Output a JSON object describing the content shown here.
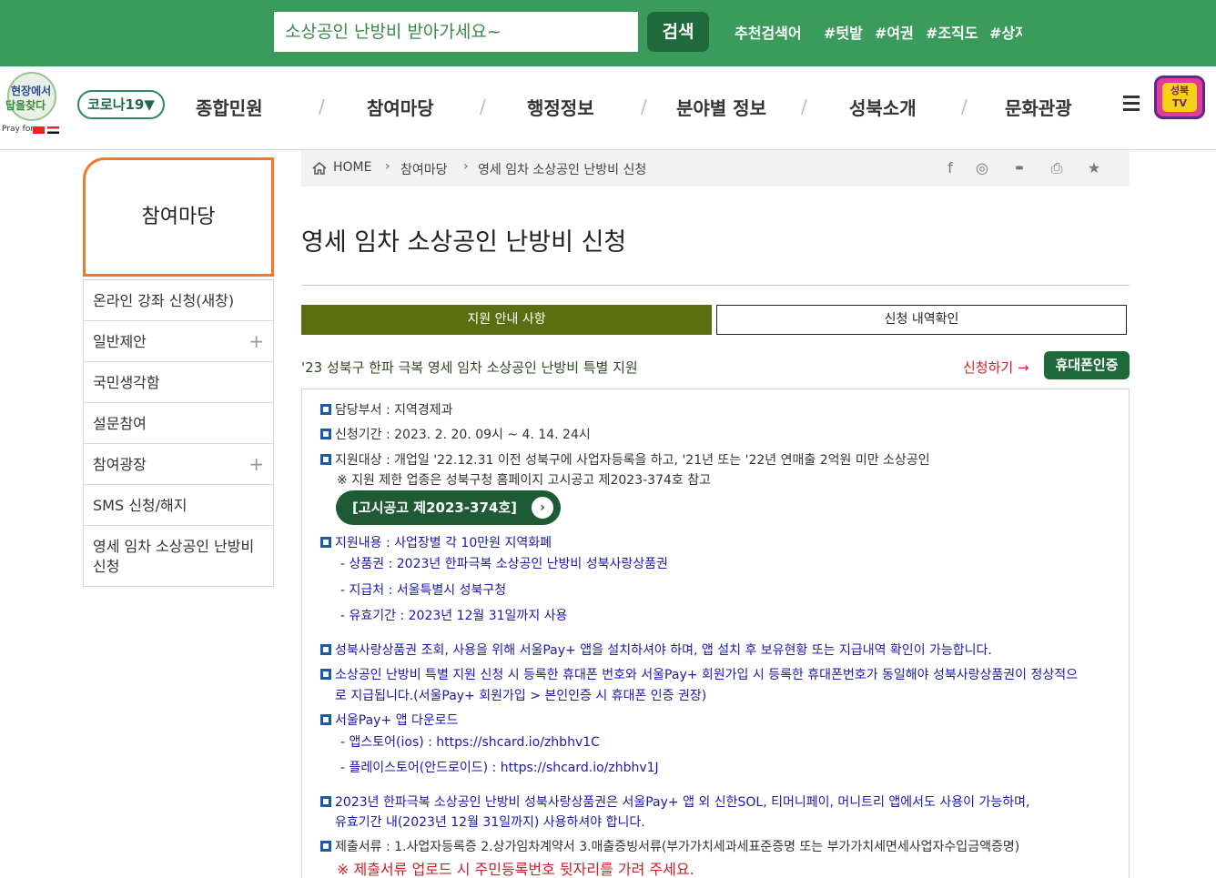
{
  "search": {
    "value": "소상공인 난방비 받아가세요~",
    "button": "검색"
  },
  "recommend": {
    "label": "추천검색어",
    "tags": [
      "#텃밭",
      "#여권",
      "#조직도",
      "#상자"
    ]
  },
  "logo": {
    "line1": "현장에서",
    "line2": "답을찾다",
    "pray": "Pray for"
  },
  "nav": {
    "corona": "코로나19▼",
    "items": [
      "종합민원",
      "참여마당",
      "행정정보",
      "분야별 정보",
      "성북소개",
      "문화관광"
    ],
    "tv": "성북 TV"
  },
  "sidebar": {
    "title": "참여마당",
    "items": [
      {
        "label": "온라인 강좌 신청(새창)",
        "plus": ""
      },
      {
        "label": "일반제안",
        "plus": "+"
      },
      {
        "label": "국민생각함",
        "plus": ""
      },
      {
        "label": "설문참여",
        "plus": ""
      },
      {
        "label": "참여광장",
        "plus": "+"
      },
      {
        "label": "SMS 신청/해지",
        "plus": ""
      },
      {
        "label": "영세 임차 소상공인 난방비 신청",
        "plus": ""
      }
    ]
  },
  "breadcrumb": {
    "home": "HOME",
    "level1": "참여마당",
    "level2": "영세 임차 소상공인 난방비 신청"
  },
  "page": {
    "title": "영세 임차 소상공인 난방비 신청",
    "tabs": [
      "지원 안내 사항",
      "신청 내역확인"
    ],
    "subtitle": "'23 성북구 한파 극복 영세 임차 소상공인 난방비 특별 지원",
    "apply_label": "신청하기 →",
    "phone_button": "휴대폰인증"
  },
  "content": {
    "dept": "담당부서 : 지역경제과",
    "period": "신청기간 : 2023. 2. 20. 09시 ~ 4. 14. 24시",
    "target": "지원대상 : 개업일 '22.12.31 이전 성북구에 사업자등록을 하고, '21년 또는 '22년 연매출 2억원 미만 소상공인",
    "target_note": "※ 지원 제한 업종은 성북구청 홈페이지 고시공고 제2023-374호 참고",
    "notice_button": "[고시공고 제2023-374호]",
    "support": "지원내용 : 사업장별 각 10만원 지역화폐",
    "support_1": "- 상품권 : 2023년 한파극복 소상공인 난방비 성북사랑상품권",
    "support_2": "- 지급처 : 서울특별시 성북구청",
    "support_3": "- 유효기간 : 2023년 12월 31일까지 사용",
    "app_note": "성북사랑상품권 조회, 사용을 위해 서울Pay+ 앱을 설치하셔야 하며, 앱 설치 후 보유현황 또는 지급내역 확인이 가능합니다.",
    "phone_note_1": "소상공인 난방비 특별 지원 신청 시 등록한 휴대폰 번호와 서울Pay+ 회원가입 시 등록한 휴대폰번호가 동일해야 성북사랑상품권이 정상적으",
    "phone_note_2": "로 지급됩니다.(서울Pay+ 회원가입 > 본인인증 시 휴대폰 인증 권장)",
    "download": "서울Pay+ 앱 다운로드",
    "download_ios": "- 앱스토어(ios) : https://shcard.io/zhbhv1C",
    "download_android": "- 플레이스토어(안드로이드) : https://shcard.io/zhbhv1J",
    "usage_1": "2023년 한파극복 소상공인 난방비 성북사랑상품권은 서울Pay+ 앱 외 신한SOL, 티머니페이, 머니트리 앱에서도 사용이 가능하며,",
    "usage_2": "유효기간 내(2023년 12월 31일까지) 사용하셔야 합니다.",
    "docs": "제출서류 : 1.사업자등록증 2.상가임차계약서 3.매출증빙서류(부가가치세과세표준증명 또는 부가가치세면세사업자수입금액증명)",
    "docs_warning": "※ 제출서류 업로드 시 주민등록번호 뒷자리를 가려 주세요."
  }
}
